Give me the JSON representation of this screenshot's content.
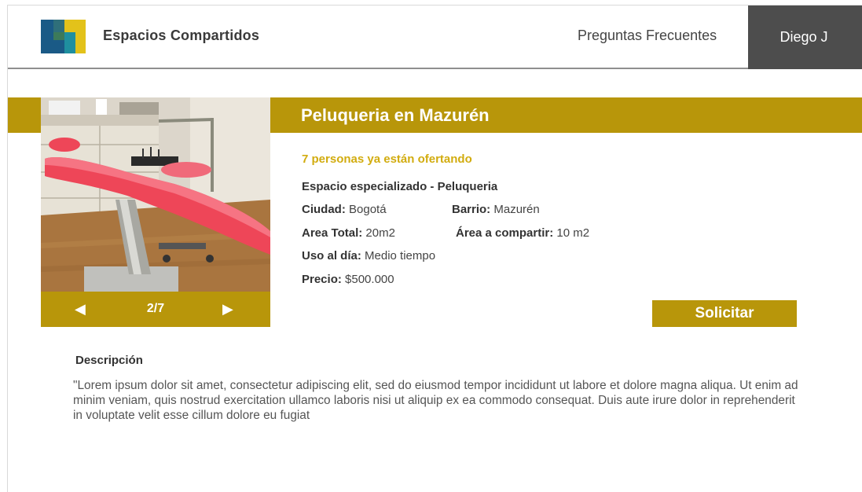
{
  "header": {
    "brand": "Espacios Compartidos",
    "faq_label": "Preguntas Frecuentes",
    "user_name": "Diego J"
  },
  "listing": {
    "title": "Peluqueria en Mazurén",
    "offering_text": "7 personas ya están ofertando",
    "category": "Espacio especializado - Peluqueria",
    "fields": {
      "city_label": "Ciudad:",
      "city_value": "Bogotá",
      "neighborhood_label": "Barrio:",
      "neighborhood_value": "Mazurén",
      "total_area_label": "Area Total:",
      "total_area_value": "20m2",
      "shared_area_label": "Área a compartir:",
      "shared_area_value": "10 m2",
      "daily_use_label": "Uso al día:",
      "daily_use_value": "Medio tiempo",
      "price_label": "Precio:",
      "price_value": "$500.000"
    },
    "request_button": "Solicitar"
  },
  "gallery": {
    "prev_icon": "◀",
    "next_icon": "▶",
    "counter": "2/7"
  },
  "description": {
    "title": "Descripción",
    "text": "\"Lorem ipsum dolor sit amet, consectetur adipiscing elit, sed do eiusmod tempor incididunt ut labore et dolore magna aliqua. Ut enim ad minim veniam, quis nostrud exercitation ullamco laboris nisi ut aliquip ex ea commodo consequat. Duis aute irure dolor in reprehenderit in voluptate velit esse cillum dolore eu fugiat"
  },
  "colors": {
    "accent": "#b8960a",
    "accent_text": "#d2ac0f",
    "user_bg": "#4d4d4d",
    "logo_blue": "#1a5a86",
    "logo_teal": "#1f7f8f",
    "logo_yellow": "#e3c21a"
  }
}
